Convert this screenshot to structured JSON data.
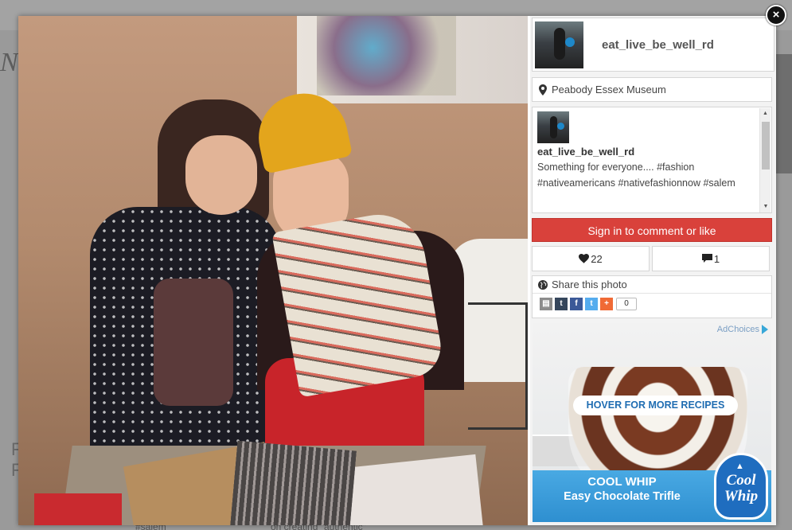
{
  "background": {
    "logo_text": "Ne",
    "left_text": "F\nF",
    "bottom_left": "#salem",
    "bottom_right": "on creating \"authentic\""
  },
  "close_label": "×",
  "photo": {
    "alt": "Two girls holding fabric swatches in a museum"
  },
  "header": {
    "username": "eat_live_be_well_rd"
  },
  "location": {
    "name": "Peabody Essex Museum"
  },
  "comment": {
    "username": "eat_live_be_well_rd",
    "text": "Something for everyone.... #fashion #nativeamericans #nativefashionnow  #salem"
  },
  "actions": {
    "signin_label": "Sign in to comment or like",
    "likes_count": "22",
    "comments_count": "1"
  },
  "share": {
    "title": "Share this photo",
    "count": "0",
    "icons": [
      "print-icon",
      "tumblr-icon",
      "facebook-icon",
      "twitter-icon",
      "plus-icon"
    ]
  },
  "ad": {
    "adchoices": "AdChoices",
    "hover_label": "HOVER FOR MORE RECIPES",
    "title": "COOL WHIP",
    "subtitle": "Easy Chocolate Trifle",
    "logo_line1": "Cool",
    "logo_line2": "Whip"
  },
  "colors": {
    "signin_red": "#d9413b",
    "ad_blue": "#2e8fd0",
    "link_blue": "#1f6db2"
  }
}
